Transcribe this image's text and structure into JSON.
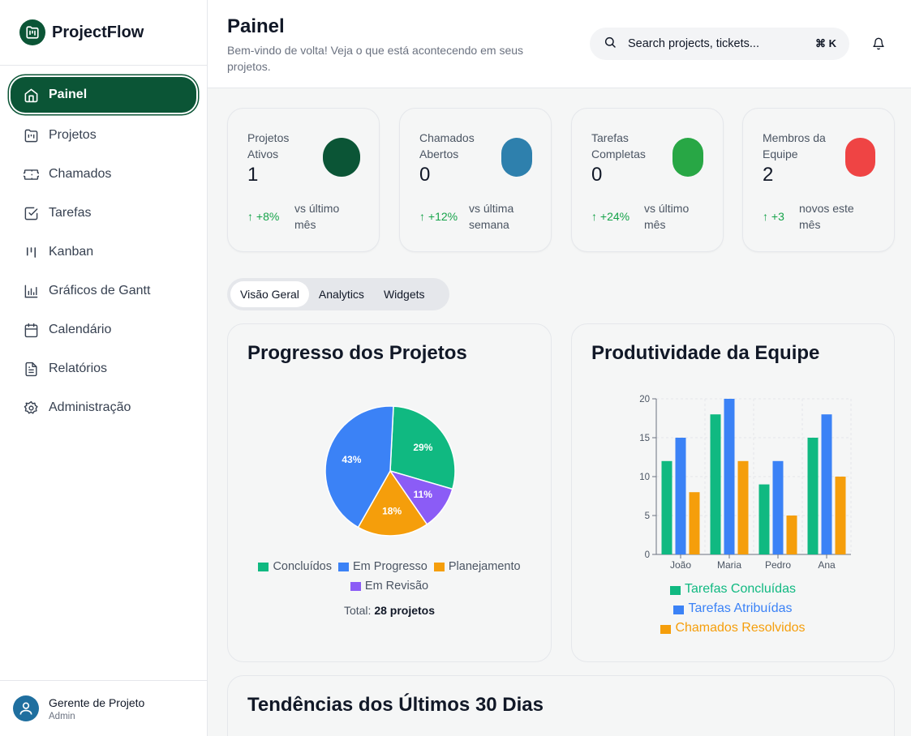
{
  "app": {
    "name": "ProjectFlow"
  },
  "sidebar": {
    "items": [
      {
        "label": "Painel",
        "icon": "home-icon",
        "active": true
      },
      {
        "label": "Projetos",
        "icon": "folder-kanban-icon"
      },
      {
        "label": "Chamados",
        "icon": "ticket-icon"
      },
      {
        "label": "Tarefas",
        "icon": "check-square-icon"
      },
      {
        "label": "Kanban",
        "icon": "kanban-icon"
      },
      {
        "label": "Gráficos de Gantt",
        "icon": "bar-chart-icon"
      },
      {
        "label": "Calendário",
        "icon": "calendar-icon"
      },
      {
        "label": "Relatórios",
        "icon": "file-text-icon"
      },
      {
        "label": "Administração",
        "icon": "settings-icon"
      }
    ]
  },
  "user": {
    "name": "Gerente de Projeto",
    "role": "Admin"
  },
  "header": {
    "title": "Painel",
    "subtitle": "Bem-vindo de volta! Veja o que está acontecendo em seus projetos.",
    "search_placeholder": "Search projects, tickets...",
    "shortcut": "⌘ K"
  },
  "stats": [
    {
      "label": "Projetos Ativos",
      "value": "1",
      "change": "+8%",
      "note": "vs último mês",
      "color": "#0b5536"
    },
    {
      "label": "Chamados Abertos",
      "value": "0",
      "change": "+12%",
      "note": "vs última semana",
      "color": "#2e80ad"
    },
    {
      "label": "Tarefas Completas",
      "value": "0",
      "change": "+24%",
      "note": "vs último mês",
      "color": "#28a745"
    },
    {
      "label": "Membros da Equipe",
      "value": "2",
      "change": "+3",
      "note": "novos este mês",
      "color": "#ef4444"
    }
  ],
  "tabs": [
    {
      "label": "Visão Geral",
      "active": true
    },
    {
      "label": "Analytics"
    },
    {
      "label": "Widgets"
    }
  ],
  "progress_card": {
    "title": "Progresso dos Projetos",
    "total_label": "Total:",
    "total_value": "28 projetos"
  },
  "productivity_card": {
    "title": "Produtividade da Equipe"
  },
  "trends_card": {
    "title": "Tendências dos Últimos 30 Dias"
  },
  "colors": {
    "primary": "#0b5536",
    "green": "#10b981",
    "blue": "#3b82f6",
    "orange": "#f59e0b",
    "purple": "#8b5cf6"
  },
  "chart_data": [
    {
      "type": "pie",
      "title": "Progresso dos Projetos",
      "labels": [
        "Concluídos",
        "Em Progresso",
        "Planejamento",
        "Em Revisão"
      ],
      "values": [
        29,
        43,
        18,
        11
      ],
      "display_order": [
        "Concluídos",
        "Em Revisão",
        "Planejamento",
        "Em Progresso"
      ],
      "colors": [
        "#10b981",
        "#3b82f6",
        "#f59e0b",
        "#8b5cf6"
      ]
    },
    {
      "type": "bar",
      "title": "Produtividade da Equipe",
      "categories": [
        "João",
        "Maria",
        "Pedro",
        "Ana"
      ],
      "series": [
        {
          "name": "Tarefas Concluídas",
          "values": [
            12,
            18,
            9,
            15
          ],
          "color": "#10b981"
        },
        {
          "name": "Tarefas Atribuídas",
          "values": [
            15,
            20,
            12,
            18
          ],
          "color": "#3b82f6"
        },
        {
          "name": "Chamados Resolvidos",
          "values": [
            8,
            12,
            5,
            10
          ],
          "color": "#f59e0b"
        }
      ],
      "ylim": [
        0,
        20
      ],
      "yticks": [
        0,
        5,
        10,
        15,
        20
      ],
      "grid": true
    }
  ]
}
